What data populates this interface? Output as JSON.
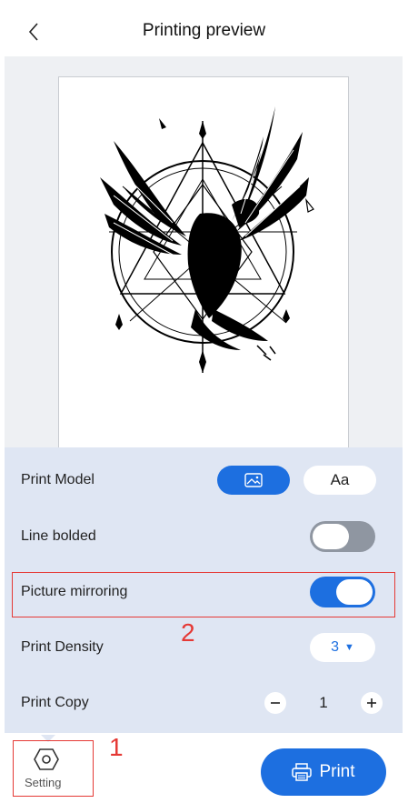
{
  "header": {
    "title": "Printing preview"
  },
  "settings": {
    "print_model": {
      "label": "Print Model",
      "text_option": "Aa",
      "selected": "image"
    },
    "line_bolded": {
      "label": "Line bolded",
      "on": false
    },
    "picture_mirroring": {
      "label": "Picture mirroring",
      "on": true
    },
    "print_density": {
      "label": "Print Density",
      "value": "3"
    },
    "print_copy": {
      "label": "Print Copy",
      "value": "1"
    }
  },
  "footer": {
    "setting_label": "Setting",
    "print_label": "Print"
  },
  "annotations": {
    "marker_1": "1",
    "marker_2": "2"
  },
  "colors": {
    "accent": "#1d6fe0",
    "panel": "#dfe6f3",
    "annotation": "#e53935"
  }
}
